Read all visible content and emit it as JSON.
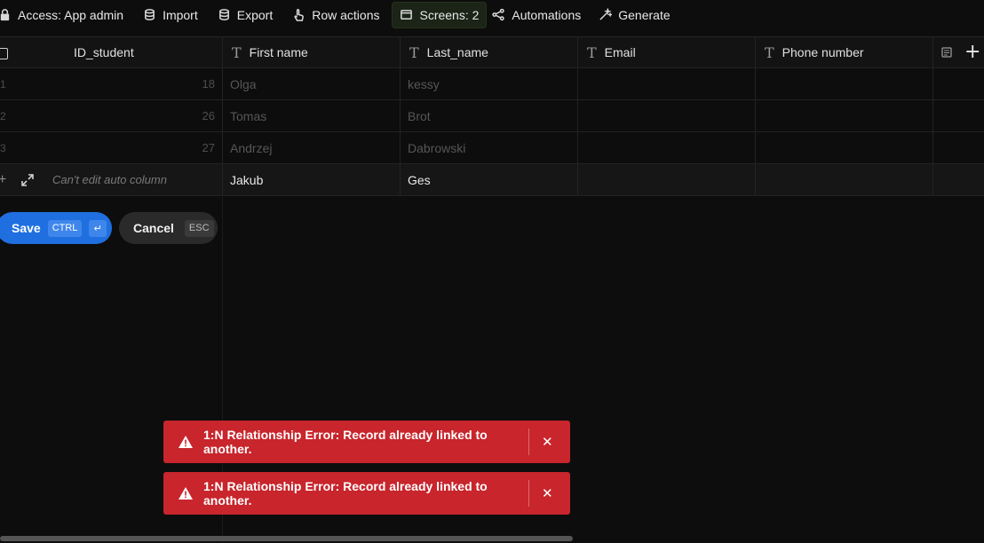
{
  "toolbar": {
    "access": "Access: App admin",
    "import": "Import",
    "export": "Export",
    "row_actions": "Row actions",
    "screens": "Screens: 2",
    "automations": "Automations",
    "generate": "Generate"
  },
  "columns": {
    "id": "ID_student",
    "first_name": "First name",
    "last_name": "Last_name",
    "email": "Email",
    "phone": "Phone number"
  },
  "rows": [
    {
      "num": "1",
      "id": "18",
      "first_name": "Olga",
      "last_name": "kessy"
    },
    {
      "num": "2",
      "id": "26",
      "first_name": "Tomas",
      "last_name": "Brot"
    },
    {
      "num": "3",
      "id": "27",
      "first_name": "Andrzej",
      "last_name": "Dabrowski"
    }
  ],
  "new_row": {
    "auto_hint": "Can't edit auto column",
    "first_name": "Jakub",
    "last_name": "Ges"
  },
  "actions": {
    "save": "Save",
    "save_kbd": "CTRL",
    "save_kbd2": "↵",
    "cancel": "Cancel",
    "cancel_kbd": "ESC"
  },
  "toasts": [
    {
      "message": "1:N Relationship Error: Record already linked to another.",
      "close": "✕"
    },
    {
      "message": "1:N Relationship Error: Record already linked to another.",
      "close": "✕"
    }
  ],
  "colors": {
    "save": "#1f6fe0",
    "error": "#c8252c",
    "background": "#0d0d0d"
  }
}
